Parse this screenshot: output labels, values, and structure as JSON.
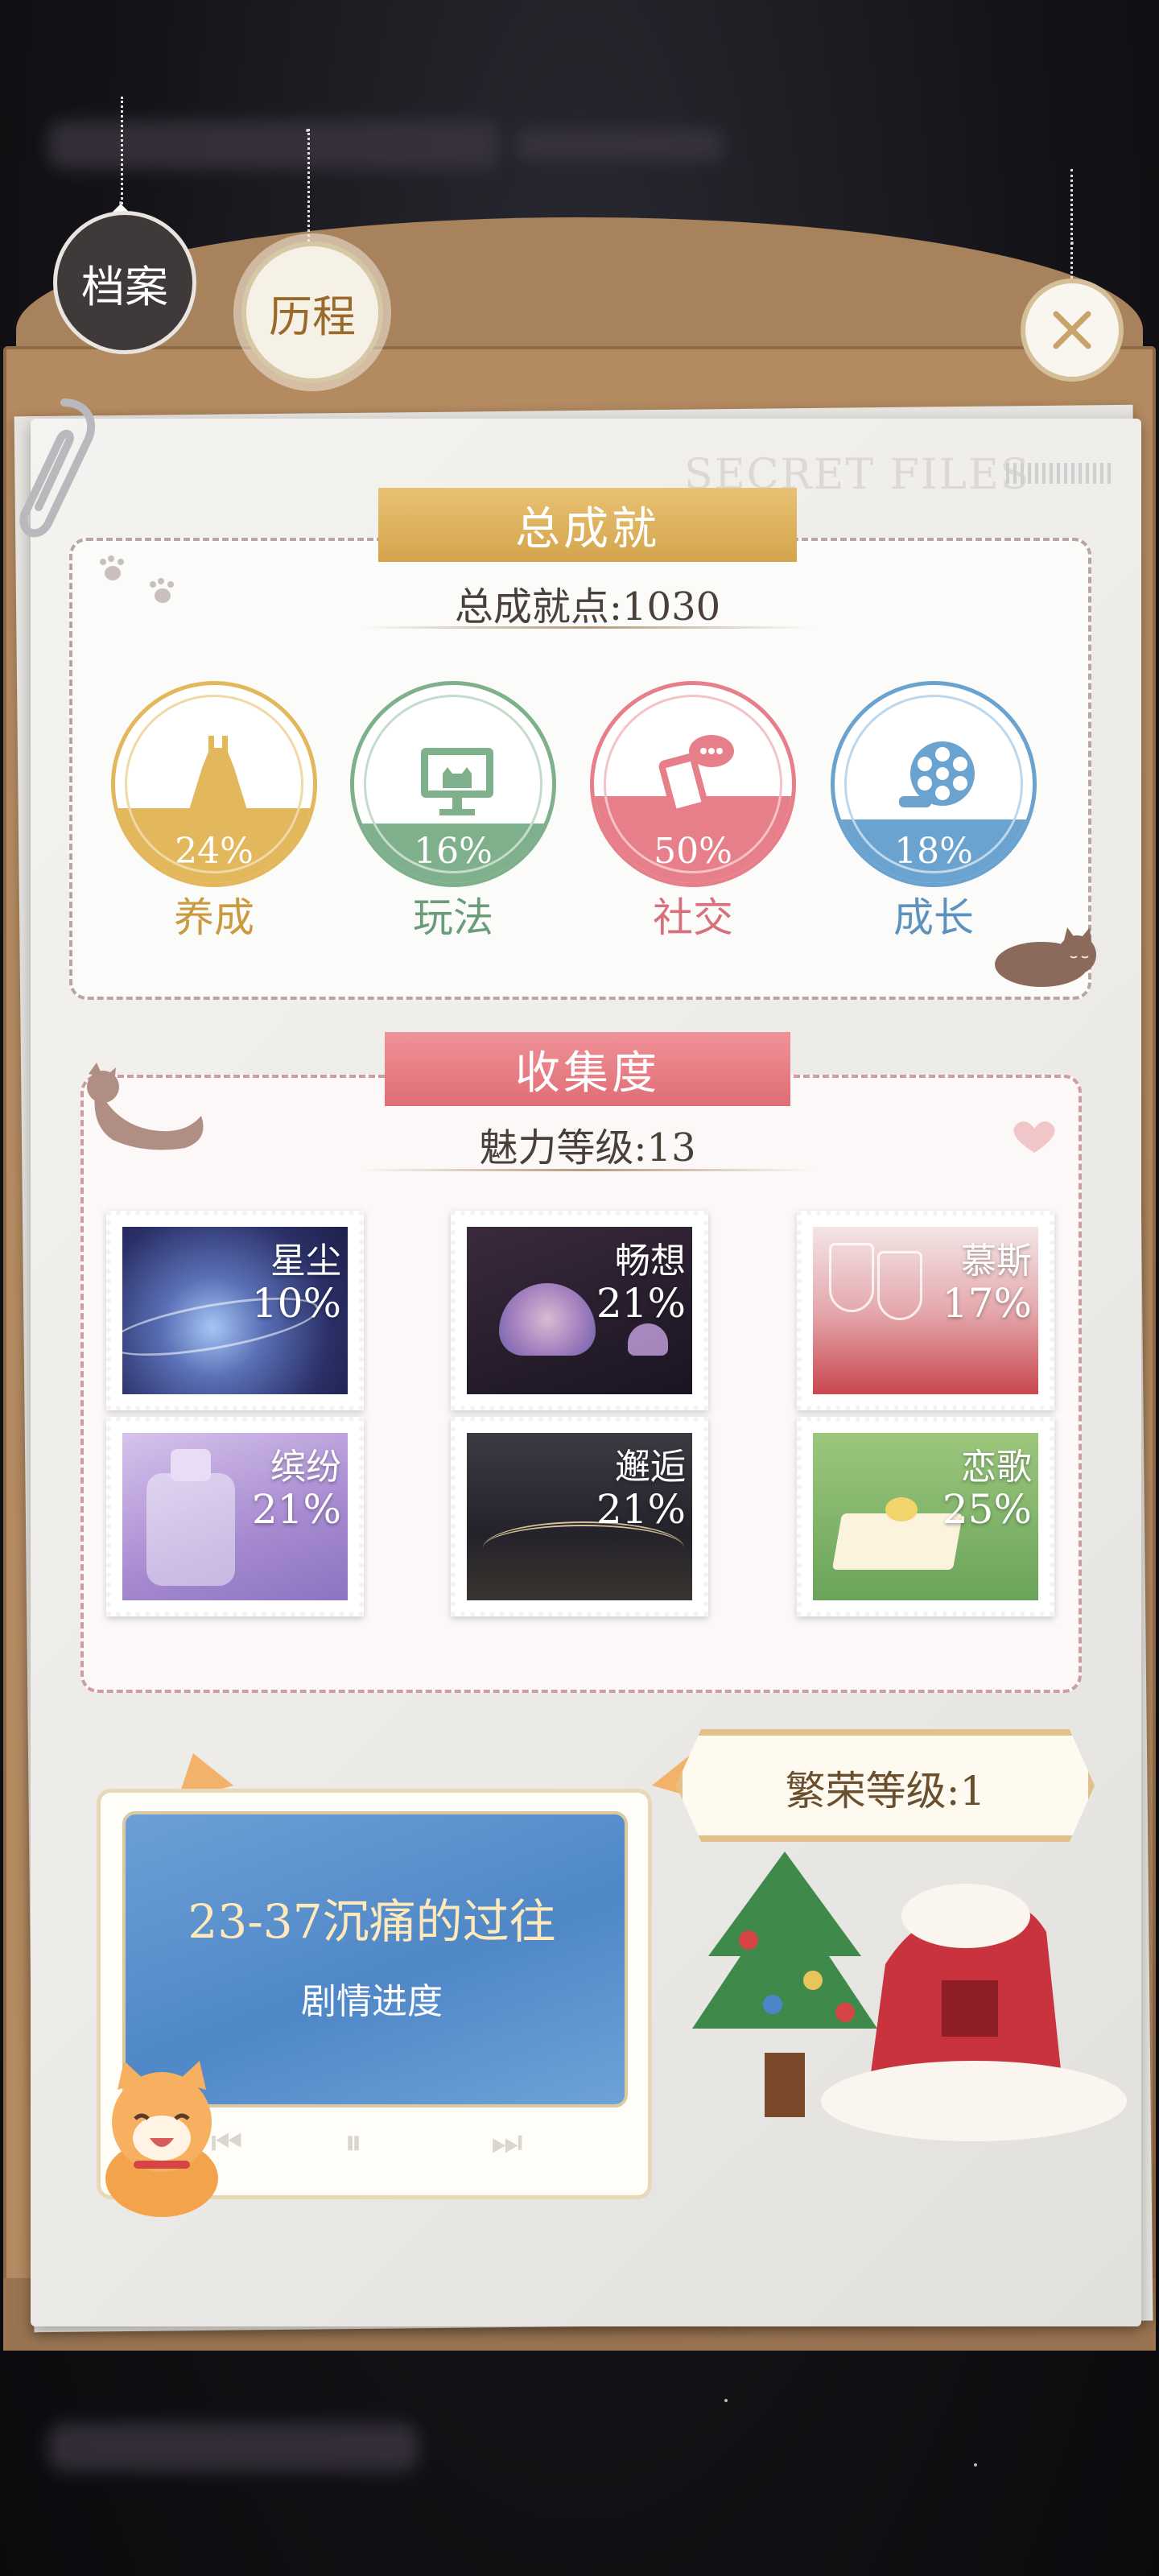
{
  "top_tabs": [
    {
      "label": "档案"
    },
    {
      "label": "历程"
    }
  ],
  "watermark": "SECRET FILES",
  "achievement": {
    "title": "总成就",
    "points_label": "总成就点:1030",
    "items": [
      {
        "label": "养成",
        "percent": "24%",
        "fill": 0.24,
        "color": "#e3b75b",
        "icon": "dress-icon"
      },
      {
        "label": "玩法",
        "percent": "16%",
        "fill": 0.16,
        "color": "#7fb08c",
        "icon": "cat-monitor-icon"
      },
      {
        "label": "社交",
        "percent": "50%",
        "fill": 0.5,
        "color": "#e77f8a",
        "icon": "phone-chat-icon"
      },
      {
        "label": "成长",
        "percent": "18%",
        "fill": 0.18,
        "color": "#6aa3cf",
        "icon": "film-reel-icon"
      }
    ]
  },
  "collection": {
    "title": "收集度",
    "charm_label": "魅力等级:13",
    "cards": [
      {
        "name": "星尘",
        "percent": "10%"
      },
      {
        "name": "畅想",
        "percent": "21%"
      },
      {
        "name": "慕斯",
        "percent": "17%"
      },
      {
        "name": "缤纷",
        "percent": "21%"
      },
      {
        "name": "邂逅",
        "percent": "21%"
      },
      {
        "name": "恋歌",
        "percent": "25%"
      }
    ]
  },
  "story": {
    "title": "23-37沉痛的过往",
    "subtitle": "剧情进度"
  },
  "prosperity": {
    "label": "繁荣等级:1"
  },
  "colors": {
    "gold": "#d4a44c",
    "pink": "#e06d75",
    "folder": "#b48a61"
  }
}
